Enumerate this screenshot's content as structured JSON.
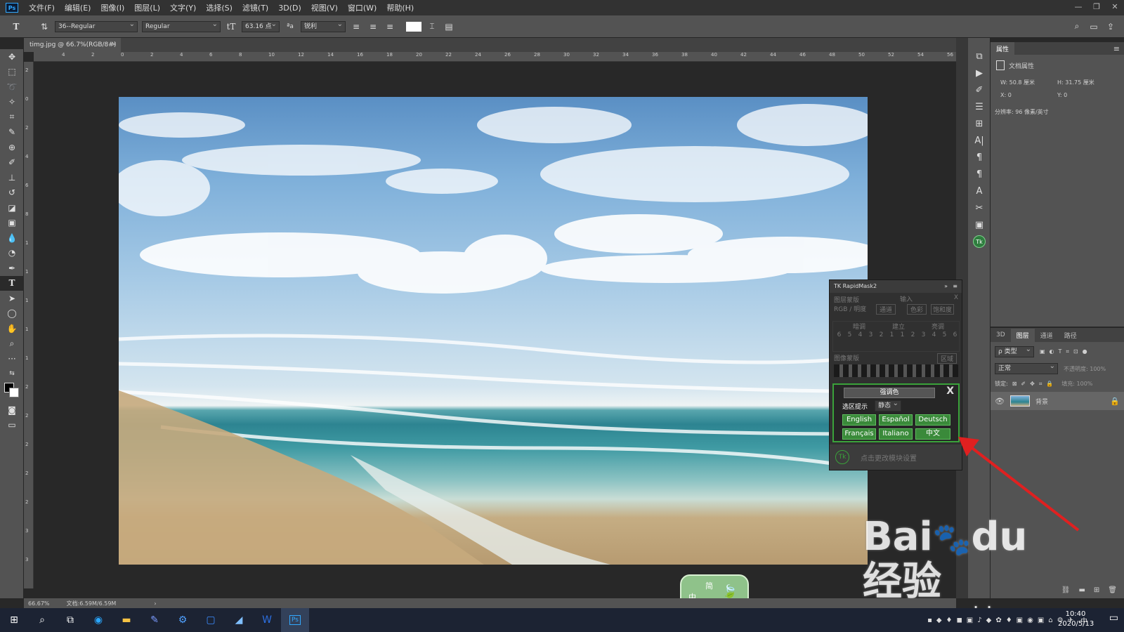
{
  "menubar": {
    "app_logo": "Ps",
    "items": [
      "文件(F)",
      "编辑(E)",
      "图像(I)",
      "图层(L)",
      "文字(Y)",
      "选择(S)",
      "滤镜(T)",
      "3D(D)",
      "视图(V)",
      "窗口(W)",
      "帮助(H)"
    ]
  },
  "options": {
    "font_family": "36--Regular",
    "font_style": "Regular",
    "font_size": "63.16 点",
    "anti_alias": "锐利"
  },
  "document": {
    "tab_label": "timg.jpg @ 66.7%(RGB/8#)"
  },
  "rulers": {
    "top": [
      "4",
      "2",
      "0",
      "2",
      "4",
      "6",
      "8",
      "10",
      "12",
      "14",
      "16",
      "18",
      "20",
      "22",
      "24",
      "26",
      "28",
      "30",
      "32",
      "34",
      "36",
      "38",
      "40",
      "42",
      "44",
      "46",
      "48",
      "50",
      "52",
      "54",
      "56"
    ],
    "left": [
      "2",
      "0",
      "2",
      "4",
      "6",
      "8",
      "1",
      "1",
      "1",
      "1",
      "1",
      "2",
      "2",
      "2",
      "2",
      "2",
      "3",
      "3"
    ]
  },
  "properties": {
    "tab": "属性",
    "doc_label": "文档属性",
    "w": "W: 50.8 厘米",
    "h": "H: 31.75 厘米",
    "x": "X: 0",
    "y": "Y: 0",
    "resolution": "分辨率: 96 像素/英寸"
  },
  "layers": {
    "tabs": [
      "3D",
      "图层",
      "通道",
      "路径"
    ],
    "kind_search": "ρ 类型",
    "blend": "正常",
    "opacity": "不透明度: 100%",
    "lock": "锁定:",
    "fill": "填充: 100%",
    "layer_name": "背景"
  },
  "rapidmask": {
    "title": "TK RapidMask2",
    "row1": [
      "图层蒙版",
      "输入",
      "X"
    ],
    "row2": [
      "RGB / 明度",
      "通道",
      "色彩",
      "饱和度"
    ],
    "row3": [
      "暗调",
      "建立",
      "亮调"
    ],
    "numbers": [
      "6",
      "5",
      "4",
      "3",
      "2",
      "1",
      "1",
      "2",
      "3",
      "4",
      "5",
      "6"
    ],
    "row4": [
      "图像蒙版",
      "区域"
    ],
    "highlight_btn": "强调色",
    "close": "X",
    "hint_label": "选区提示",
    "hint_value": "静态",
    "langs": [
      "English",
      "Español",
      "Deutsch",
      "Français",
      "Italiano",
      "中文"
    ],
    "footer": "点击更改模块设置"
  },
  "status": {
    "zoom": "66.67%",
    "doc": "文档:6.59M/6.59M"
  },
  "taskbar": {
    "time": "10:40",
    "date": "2020/5/13",
    "ime": "中"
  },
  "ime_float": {
    "line1": "简",
    "line2": "中"
  },
  "watermark": "Baidu经验 jingyan.baidu.com",
  "colors": {
    "accent_green": "#3aa23a",
    "arrow_red": "#e02020"
  }
}
